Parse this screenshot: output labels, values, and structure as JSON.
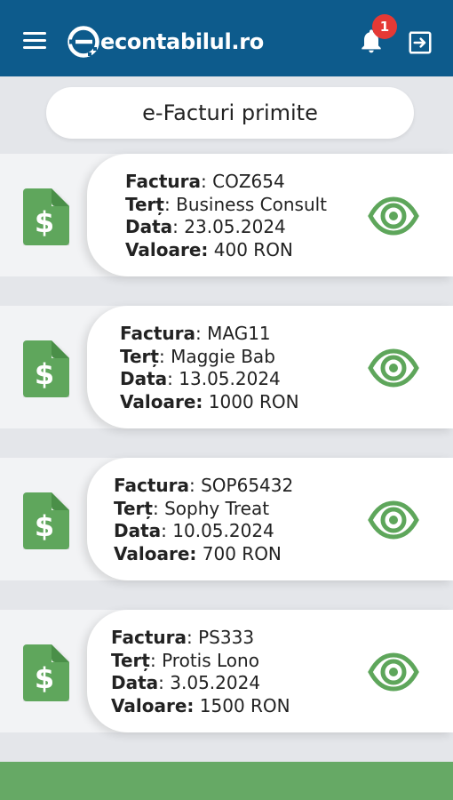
{
  "header": {
    "logo_text": "econtabilul.ro",
    "notification_count": "1",
    "colors": {
      "bar": "#0d5b8c",
      "badge": "#e53935",
      "accent": "#5ea65b"
    }
  },
  "page_title": "e-Facturi primite",
  "labels": {
    "factura": "Factura",
    "tert": "Terț",
    "data": "Data",
    "valoare": "Valoare:"
  },
  "invoices": [
    {
      "number": "COZ654",
      "partner": "Business Consult",
      "date": "23.05.2024",
      "value": "400 RON"
    },
    {
      "number": "MAG11",
      "partner": "Maggie Bab",
      "date": "13.05.2024",
      "value": "1000 RON"
    },
    {
      "number": "SOP65432",
      "partner": "Sophy Treat",
      "date": "10.05.2024",
      "value": "700 RON"
    },
    {
      "number": "PS333",
      "partner": "Protis Lono",
      "date": "3.05.2024",
      "value": "1500 RON"
    }
  ],
  "icons": {
    "menu": "hamburger-menu-icon",
    "bell": "bell-icon",
    "logout": "logout-icon",
    "document": "invoice-document-dollar-icon",
    "view": "eye-icon"
  }
}
